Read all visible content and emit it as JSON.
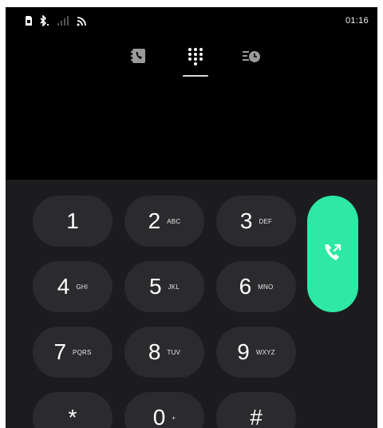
{
  "status_bar": {
    "time": "01:16",
    "icons": [
      "sim-icon",
      "bluetooth-icon",
      "signal-icon",
      "wifi-icon"
    ]
  },
  "tabs": [
    {
      "icon": "contacts-icon",
      "selected": false
    },
    {
      "icon": "dialpad-icon",
      "selected": true
    },
    {
      "icon": "recents-icon",
      "selected": false
    }
  ],
  "keypad": {
    "keys": [
      {
        "digit": "1",
        "letters": ""
      },
      {
        "digit": "2",
        "letters": "ABC"
      },
      {
        "digit": "3",
        "letters": "DEF"
      },
      {
        "digit": "4",
        "letters": "GHI"
      },
      {
        "digit": "5",
        "letters": "JKL"
      },
      {
        "digit": "6",
        "letters": "MNO"
      },
      {
        "digit": "7",
        "letters": "PQRS"
      },
      {
        "digit": "8",
        "letters": "TUV"
      },
      {
        "digit": "9",
        "letters": "WXYZ"
      },
      {
        "digit": "*",
        "letters": ""
      },
      {
        "digit": "0",
        "letters": "+"
      },
      {
        "digit": "#",
        "letters": ""
      }
    ]
  },
  "call_button": {
    "icon": "phone-call-icon"
  },
  "colors": {
    "background": "#000000",
    "keypad_background": "#1c1c1e",
    "key_background": "#2b2b2e",
    "call_accent": "#2ee8a6",
    "text": "#ffffff"
  }
}
